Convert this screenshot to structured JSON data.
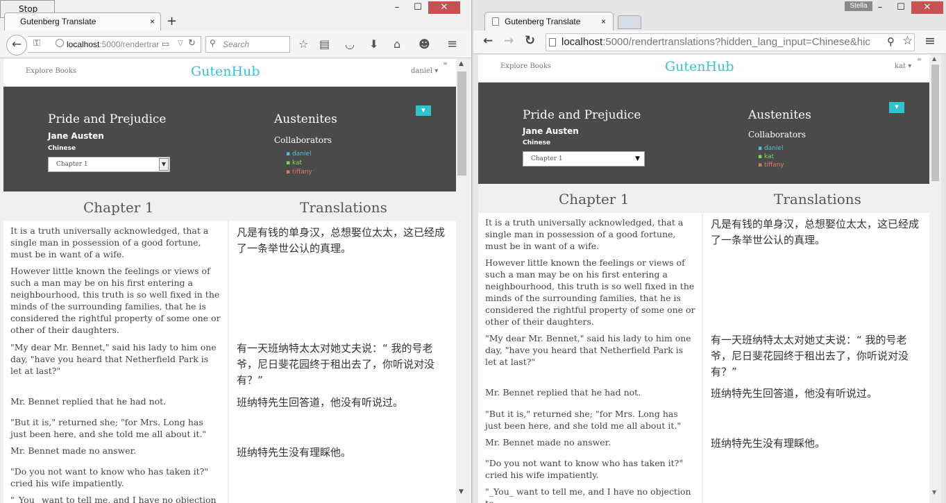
{
  "left_browser": {
    "stop_label": "Stop",
    "tab_title": "Gutenberg Translate",
    "tab_close": "×",
    "new_tab": "+",
    "url_host": "localhost",
    "url_rest": ":5000/rendertrar",
    "search_placeholder": "Search",
    "controls": {
      "minimize": "–",
      "maximize": "☐",
      "close": "✕"
    }
  },
  "right_browser": {
    "tab_title": "Gutenberg Translate",
    "tab_close": "×",
    "user_badge": "Stella",
    "url_host": "localhost",
    "url_rest": ":5000/rendertranslations?hidden_lang_input=Chinese&hic",
    "controls": {
      "minimize": "–",
      "maximize": "☐",
      "close": "✕"
    }
  },
  "left_page": {
    "nav": {
      "explore": "Explore Books",
      "logo": "GutenHub",
      "user": "daniel ▾"
    },
    "book": {
      "title": "Pride and Prejudice",
      "author": "Jane Austen",
      "language": "Chinese",
      "chapter_select": "Chapter 1"
    },
    "group": {
      "name": "Austenites",
      "collab_label": "Collaborators",
      "collaborators": [
        "daniel",
        "kat",
        "tiffany"
      ]
    },
    "chapter_heading": "Chapter 1",
    "translations_heading": "Translations",
    "paragraphs": [
      "It is a truth universally acknowledged, that a single man in possession of a good fortune, must be in want of a wife.",
      "However little known the feelings or views of such a man may be on his first entering a neighbourhood, this truth is so well fixed in the minds of the surrounding families, that he is considered the rightful property of some one or other of their daughters.",
      "\"My dear Mr. Bennet,\" said his lady to him one day, \"have you heard that Netherfield Park is let at last?\"",
      "Mr. Bennet replied that he had not.",
      "\"But it is,\" returned she; \"for Mrs. Long has just been here, and she told me all about it.\"",
      "Mr. Bennet made no answer.",
      "\"Do you not want to know who has taken it?\" cried his wife impatiently.",
      "\"_You_ want to tell me, and I have no objection to"
    ],
    "translations": [
      "凡是有钱的单身汉，总想娶位太太，这已经成了一条举世公认的真理。",
      "有一天班纳特太太对她丈夫说：“ 我的号老爷，尼日斐花园终于租出去了，你听说对没有？”",
      "班纳特先生回答道，他没有听说过。",
      "班纳特先生没有理睬他。"
    ]
  },
  "right_page": {
    "nav": {
      "explore": "Explore Books",
      "logo": "GutenHub",
      "user": "kat ▾"
    },
    "book": {
      "title": "Pride and Prejudice",
      "author": "Jane Austen",
      "language": "Chinese",
      "chapter_select": "Chapter 1"
    },
    "group": {
      "name": "Austenites",
      "collab_label": "Collaborators",
      "collaborators": [
        "daniel",
        "kat",
        "tiffany"
      ]
    },
    "chapter_heading": "Chapter 1",
    "translations_heading": "Translations"
  },
  "colors": {
    "accent": "#3cbfd0",
    "hero_bg": "#4a4a4a",
    "collab_daniel": "#4fc3e0",
    "collab_kat": "#7ed957",
    "collab_tiffany": "#e07a6a"
  }
}
